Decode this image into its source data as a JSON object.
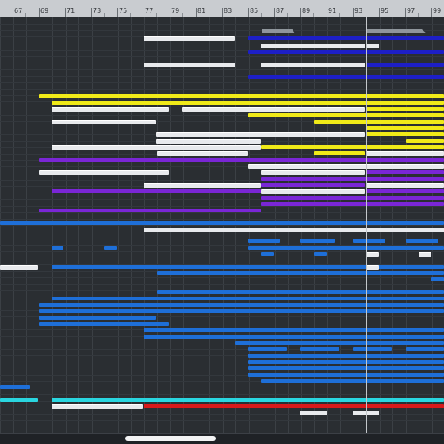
{
  "ruler": {
    "bars": [
      "67",
      "69",
      "71",
      "73",
      "75",
      "77",
      "79",
      "81",
      "83",
      "85",
      "87",
      "89",
      "91",
      "93",
      "95",
      "97",
      "99"
    ]
  },
  "markers": [
    {
      "label": ""
    },
    {
      "label": ""
    }
  ],
  "colors": {
    "background": "#2b2f33",
    "ruler": "#c9ccd0",
    "white_part": "#e8eaed",
    "yellow_part": "#f0ea18",
    "purple_part": "#7a26d6",
    "blue_part": "#1e6fd8",
    "navy_part": "#1d1fc6",
    "cyan_part": "#2ad6e0",
    "red_part": "#d81a1a",
    "playhead": "#c3c7cb"
  },
  "scrollbar": {
    "orientation": "horizontal"
  }
}
